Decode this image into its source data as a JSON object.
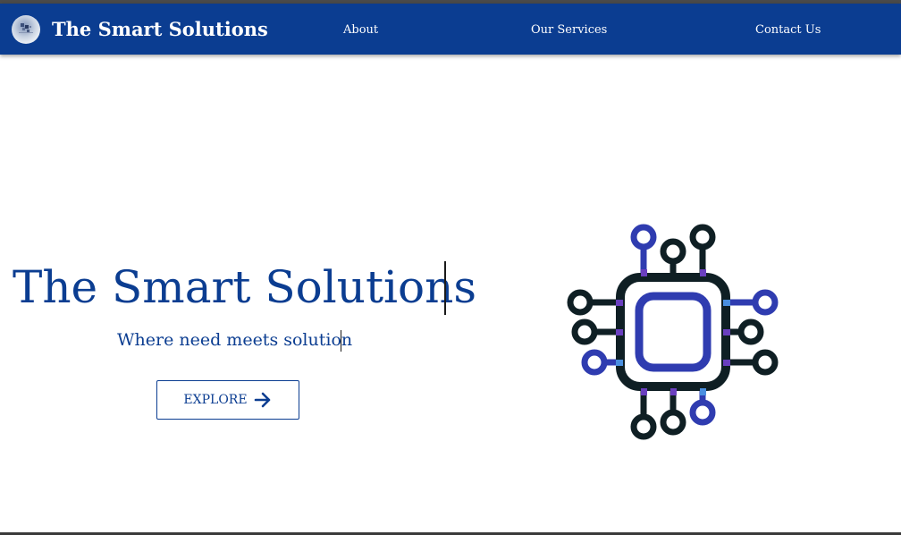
{
  "header": {
    "brand": "The Smart Solutions",
    "nav": [
      {
        "label": "About"
      },
      {
        "label": "Our Services"
      },
      {
        "label": "Contact Us"
      }
    ]
  },
  "hero": {
    "title": "The Smart Solutions",
    "subtitle": "Where need meets solution",
    "cta_label": "EXPLORE",
    "cta_icon": "arrow-right-icon"
  },
  "illustration": {
    "icon": "circuit-chip-icon"
  },
  "colors": {
    "brand": "#0b3d91",
    "chip_dark": "#0f1f24",
    "chip_blue": "#2f3cb0",
    "chip_purple": "#6a3fbf",
    "chip_light_blue": "#4a8fe0"
  }
}
